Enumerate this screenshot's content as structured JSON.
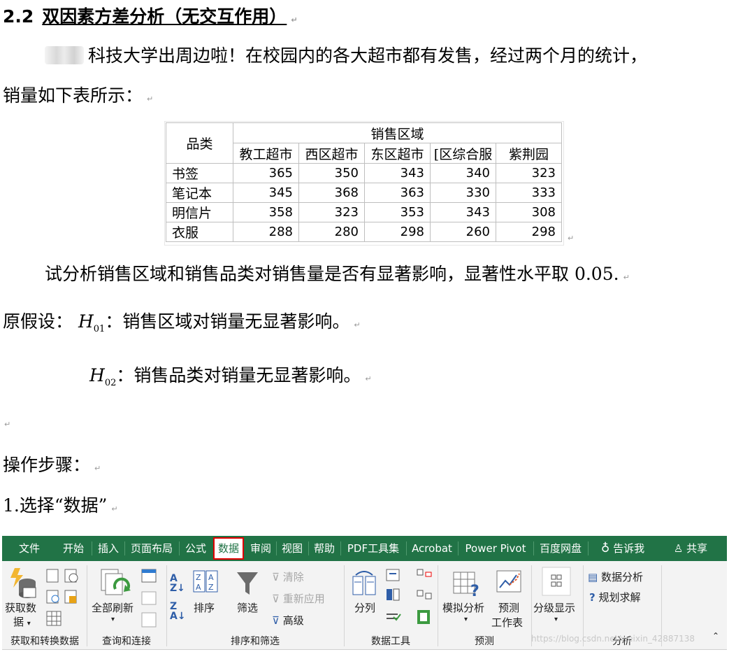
{
  "heading": {
    "number": "2.2",
    "title": "双因素方差分析（无交互作用）"
  },
  "intro_line1": "科技大学出周边啦！在校园内的各大超市都有发售，经过两个月的统计，",
  "intro_line2": "销量如下表所示：",
  "table": {
    "row_header": "品类",
    "group_header": "销售区域",
    "columns": [
      "教工超市",
      "西区超市",
      "东区超市",
      "[区综合服",
      "紫荆园"
    ],
    "rows": [
      {
        "label": "书签",
        "values": [
          "365",
          "350",
          "343",
          "340",
          "323"
        ]
      },
      {
        "label": "笔记本",
        "values": [
          "345",
          "368",
          "363",
          "330",
          "333"
        ]
      },
      {
        "label": "明信片",
        "values": [
          "358",
          "323",
          "353",
          "343",
          "308"
        ]
      },
      {
        "label": "衣服",
        "values": [
          "288",
          "280",
          "298",
          "260",
          "298"
        ]
      }
    ]
  },
  "question": "试分析销售区域和销售品类对销售量是否有显著影响，显著性水平取 0.05.",
  "hyp_label": "原假设：",
  "h_symbol": "H",
  "h01_sub": "01",
  "h01_text": "：销售区域对销量无显著影响。",
  "h02_sub": "02",
  "h02_text": "：销售品类对销量无显著影响。",
  "steps_label": "操作步骤：",
  "step1": "1.选择“数据”",
  "ribbon": {
    "tabs": [
      "文件",
      "开始",
      "插入",
      "页面布局",
      "公式",
      "数据",
      "审阅",
      "视图",
      "帮助",
      "PDF工具集",
      "Acrobat",
      "Power Pivot",
      "百度网盘",
      "告诉我",
      "共享"
    ],
    "active_tab": "数据",
    "get_data": "获取数",
    "get_data2": "据",
    "refresh_all": "全部刷新",
    "sort": "排序",
    "filter": "筛选",
    "clear": "清除",
    "reapply": "重新应用",
    "advanced": "高级",
    "text_to_columns": "分列",
    "what_if": "模拟分析",
    "forecast1": "预测",
    "forecast2": "工作表",
    "outline": "分级显示",
    "data_analysis": "数据分析",
    "solver": "规划求解",
    "groups": [
      "获取和转换数据",
      "查询和连接",
      "排序和筛选",
      "数据工具",
      "预测",
      "分析"
    ],
    "accent": "#217346"
  },
  "watermark": "https://blog.csdn.net/weixin_42887138"
}
